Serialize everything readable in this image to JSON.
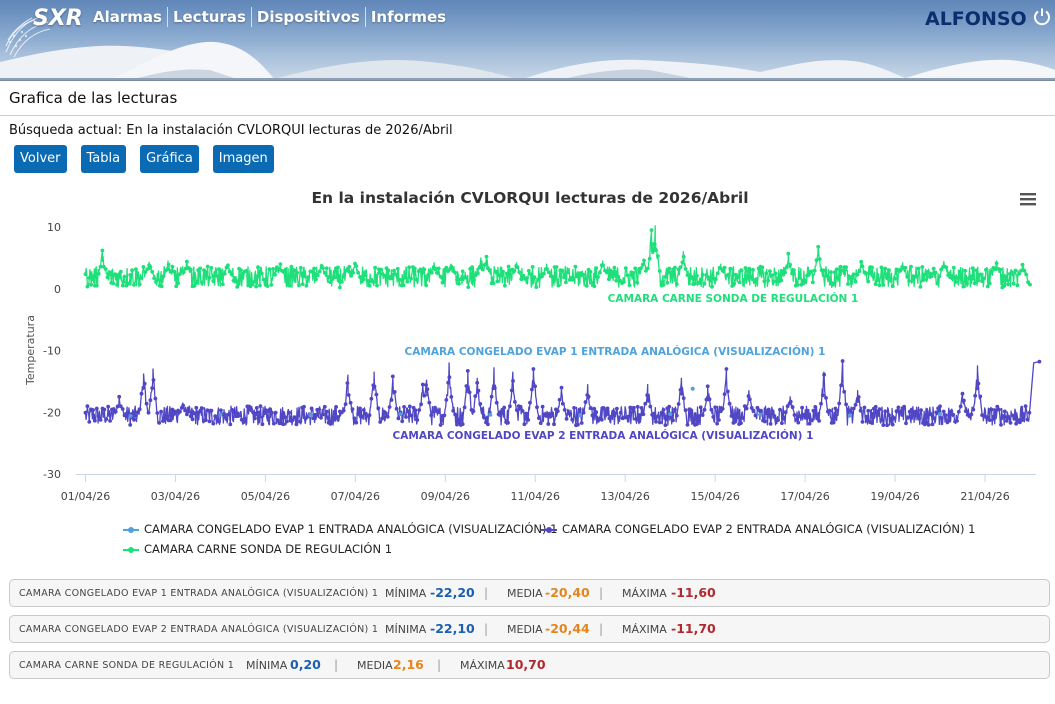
{
  "header": {
    "logo": "SXR",
    "nav": [
      "Alarmas",
      "Lecturas",
      "Dispositivos",
      "Informes"
    ],
    "user": "ALFONSO",
    "power_icon": "power-icon"
  },
  "page": {
    "title": "Grafica de las lecturas",
    "search_label": "Búsqueda actual: En la instalación CVLORQUI lecturas de 2026/Abril",
    "buttons": [
      "Volver",
      "Tabla",
      "Gráfica",
      "Imagen"
    ]
  },
  "chart_data": {
    "type": "line",
    "title": "En la instalación CVLORQUI lecturas de 2026/Abril",
    "ylabel": "Temperatura",
    "xlabel": "",
    "ylim": [
      -30,
      10
    ],
    "yticks": [
      10,
      0,
      -10,
      -20,
      -30
    ],
    "xlim": [
      "01/04/26",
      "22/04/26"
    ],
    "xticks": [
      "01/04/26",
      "03/04/26",
      "05/04/26",
      "07/04/26",
      "09/04/26",
      "11/04/26",
      "13/04/26",
      "15/04/26",
      "17/04/26",
      "19/04/26",
      "21/04/26"
    ],
    "legend_position": "bottom",
    "grid": "none",
    "series": [
      {
        "name": "CAMARA CONGELADO EVAP 1 ENTRADA ANALÓGICA (VISUALIZACIÓN) 1",
        "color": "#4fa3dd",
        "label": "CAMARA CONGELADO EVAP 1 ENTRADA ANALÓGICA (VISUALIZACIÓN) 1",
        "x": [
          "2026-04-02",
          "2026-04-04",
          "2026-04-06",
          "2026-04-08",
          "2026-04-10",
          "2026-04-12",
          "2026-04-14",
          "2026-04-14 12:00",
          "2026-04-16",
          "2026-04-18",
          "2026-04-20"
        ],
        "y": [
          -20.6,
          -20.4,
          -20.5,
          -20.3,
          -20.4,
          -20.5,
          -20.3,
          -16.2,
          -20.4,
          -20.5,
          -20.3
        ]
      },
      {
        "name": "CAMARA CONGELADO EVAP 2 ENTRADA ANALÓGICA (VISUALIZACIÓN) 1",
        "color": "#5147c4",
        "label": "CAMARA CONGELADO EVAP 2 ENTRADA ANALÓGICA (VISUALIZACIÓN) 1",
        "noise_band": [
          -22.1,
          -19.0
        ],
        "peaks": [
          [
            "2026-04-01 18:00",
            -17.5
          ],
          [
            "2026-04-02 07:00",
            -13.8
          ],
          [
            "2026-04-02 12:00",
            -13.0
          ],
          [
            "2026-04-03 04:00",
            -18.5
          ],
          [
            "2026-04-06 20:00",
            -14.0
          ],
          [
            "2026-04-07 10:00",
            -13.5
          ],
          [
            "2026-04-07 20:00",
            -14.2
          ],
          [
            "2026-04-08 12:00",
            -15.5
          ],
          [
            "2026-04-08 14:00",
            -14.8
          ],
          [
            "2026-04-09 02:00",
            -12.0
          ],
          [
            "2026-04-09 12:00",
            -13.3
          ],
          [
            "2026-04-09 17:00",
            -14.5
          ],
          [
            "2026-04-10 02:00",
            -12.8
          ],
          [
            "2026-04-10 12:00",
            -13.5
          ],
          [
            "2026-04-10 23:00",
            -13.0
          ],
          [
            "2026-04-11 14:00",
            -16.0
          ],
          [
            "2026-04-12 04:00",
            -15.5
          ],
          [
            "2026-04-13 12:00",
            -15.5
          ],
          [
            "2026-04-14 06:00",
            -14.5
          ],
          [
            "2026-04-14 20:00",
            -15.8
          ],
          [
            "2026-04-15 06:00",
            -13.0
          ],
          [
            "2026-04-15 18:00",
            -16.5
          ],
          [
            "2026-04-16 16:00",
            -17.5
          ],
          [
            "2026-04-17 10:00",
            -13.5
          ],
          [
            "2026-04-17 20:00",
            -11.7
          ],
          [
            "2026-04-18 04:00",
            -16.5
          ],
          [
            "2026-04-20 12:00",
            -17.0
          ],
          [
            "2026-04-20 20:00",
            -12.5
          ],
          [
            "2026-04-22 02:00",
            -12.0
          ],
          [
            "2026-04-22 05:00",
            -11.8
          ]
        ]
      },
      {
        "name": "CAMARA CARNE SONDA DE REGULACIÓN 1",
        "color": "#1ee07a",
        "label": "CAMARA CARNE SONDA DE REGULACIÓN 1",
        "noise_band": [
          0.2,
          3.6
        ],
        "peaks": [
          [
            "2026-04-01 09:00",
            6.2
          ],
          [
            "2026-04-02 10:00",
            4.3
          ],
          [
            "2026-04-02 20:00",
            4.5
          ],
          [
            "2026-04-03 06:00",
            4.6
          ],
          [
            "2026-04-04 04:00",
            3.8
          ],
          [
            "2026-04-05 08:00",
            4.0
          ],
          [
            "2026-04-06 06:00",
            4.0
          ],
          [
            "2026-04-07 00:00",
            4.3
          ],
          [
            "2026-04-08 18:00",
            4.2
          ],
          [
            "2026-04-09 03:00",
            4.0
          ],
          [
            "2026-04-09 19:00",
            5.0
          ],
          [
            "2026-04-09 22:00",
            5.2
          ],
          [
            "2026-04-10 14:00",
            4.2
          ],
          [
            "2026-04-11 06:00",
            4.0
          ],
          [
            "2026-04-12 12:00",
            4.5
          ],
          [
            "2026-04-13 10:00",
            4.7
          ],
          [
            "2026-04-13 14:00",
            9.5
          ],
          [
            "2026-04-13 16:00",
            10.2
          ],
          [
            "2026-04-14 07:00",
            6.0
          ],
          [
            "2026-04-15 03:00",
            4.0
          ],
          [
            "2026-04-16 15:00",
            5.7
          ],
          [
            "2026-04-17 07:00",
            6.8
          ],
          [
            "2026-04-18 06:00",
            4.5
          ],
          [
            "2026-04-19 04:00",
            4.2
          ],
          [
            "2026-04-20 02:00",
            4.4
          ],
          [
            "2026-04-21 06:00",
            4.5
          ],
          [
            "2026-04-21 20:00",
            3.9
          ]
        ]
      }
    ]
  },
  "menu_icon": "hamburger-menu-icon",
  "stats": [
    {
      "name": "CAMARA CONGELADO EVAP 1 ENTRADA ANALÓGICA (VISUALIZACIÓN) 1",
      "min_label": "MÍNIMA",
      "min": "-22,20",
      "avg_label": "MEDIA",
      "avg": "-20,40",
      "max_label": "MÁXIMA",
      "max": "-11,60"
    },
    {
      "name": "CAMARA CONGELADO EVAP 2 ENTRADA ANALÓGICA (VISUALIZACIÓN) 1",
      "min_label": "MÍNIMA",
      "min": "-22,10",
      "avg_label": "MEDIA",
      "avg": "-20,44",
      "max_label": "MÁXIMA",
      "max": "-11,70"
    },
    {
      "name": "CAMARA CARNE SONDA DE REGULACIÓN 1",
      "min_label": "MÍNIMA",
      "min": "0,20",
      "avg_label": "MEDIA",
      "avg": "2,16",
      "max_label": "MÁXIMA",
      "max": "10,70"
    }
  ]
}
